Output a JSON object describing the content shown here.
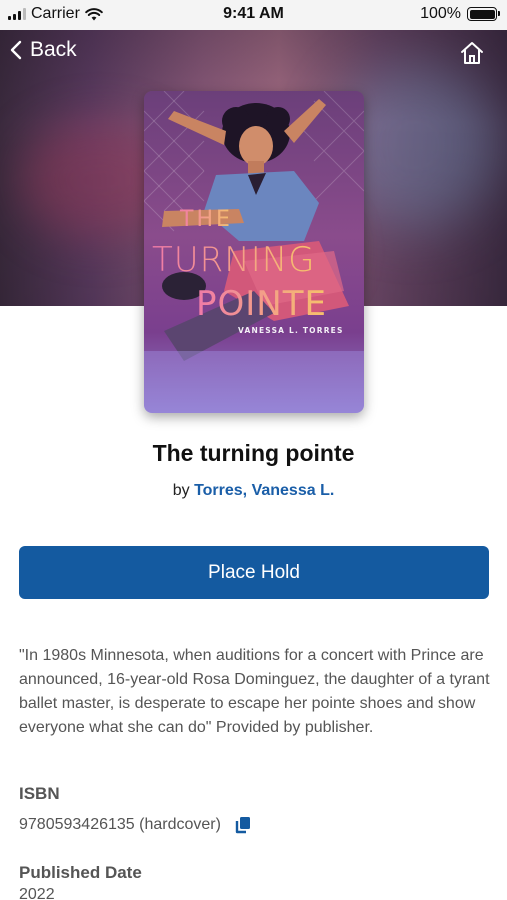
{
  "status_bar": {
    "carrier": "Carrier",
    "time": "9:41 AM",
    "battery": "100%"
  },
  "nav": {
    "back_label": "Back",
    "back_icon": "chevron-left-icon",
    "home_icon": "home-icon"
  },
  "cover": {
    "title_line1": "THE",
    "title_line2": "TURNING",
    "title_line3": "POINTE",
    "author": "VANESSA L. TORRES"
  },
  "book": {
    "title": "The turning pointe",
    "by_prefix": "by",
    "author": "Torres, Vanessa L."
  },
  "actions": {
    "place_hold_label": "Place Hold"
  },
  "description": "\"In 1980s Minnesota, when auditions for a concert with Prince are announced, 16-year-old Rosa Dominguez, the daughter of a tyrant ballet master, is desperate to escape her pointe shoes and show everyone what she can do\" Provided by publisher.",
  "details": {
    "isbn_label": "ISBN",
    "isbn_value": "9780593426135 (hardcover)",
    "copy_icon": "copy-icon",
    "published_label": "Published Date",
    "published_value": "2022"
  },
  "colors": {
    "accent": "#145aa0",
    "link": "#1a5ea8"
  }
}
